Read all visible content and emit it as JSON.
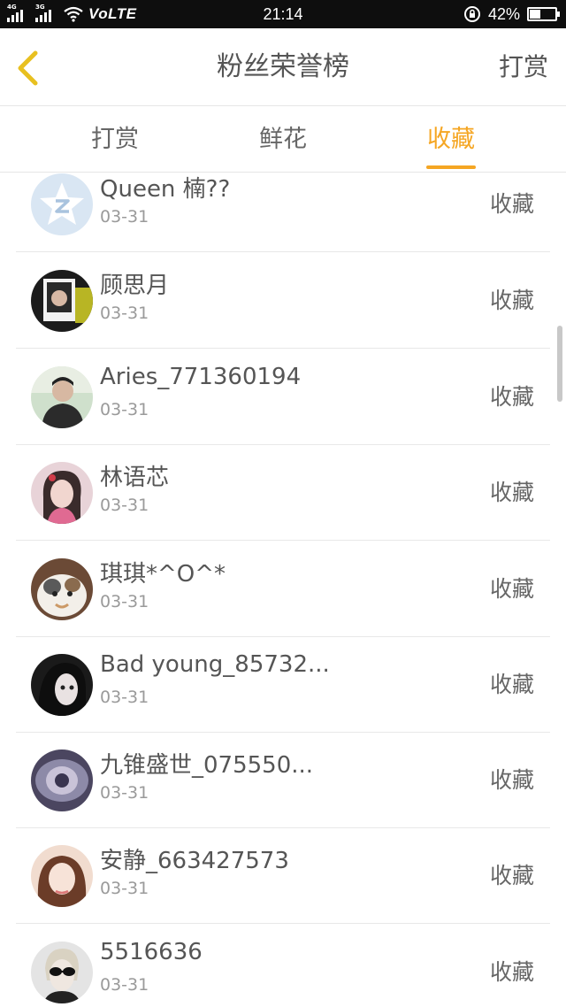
{
  "status_bar": {
    "sim1": "4G",
    "sim2": "3G",
    "network": "VoLTE",
    "time": "21:14",
    "battery": "42%",
    "battery_level": 0.42
  },
  "header": {
    "title": "粉丝荣誉榜",
    "right_action": "打赏"
  },
  "tabs": [
    {
      "label": "打赏",
      "active": false
    },
    {
      "label": "鲜花",
      "active": false
    },
    {
      "label": "收藏",
      "active": true
    }
  ],
  "list": [
    {
      "name": "Queen 楠??",
      "date": "03-31",
      "action": "收藏",
      "avatar": "default-q-avatar"
    },
    {
      "name": "顾思月",
      "date": "03-31",
      "action": "收藏",
      "avatar": "photo-avatar"
    },
    {
      "name": "Aries_771360194",
      "date": "03-31",
      "action": "收藏",
      "avatar": "photo-avatar"
    },
    {
      "name": "林语芯",
      "date": "03-31",
      "action": "收藏",
      "avatar": "photo-avatar"
    },
    {
      "name": "琪琪*^O^*",
      "date": "03-31",
      "action": "收藏",
      "avatar": "photo-avatar"
    },
    {
      "name": "Bad young_85732...",
      "date": "03-31",
      "action": "收藏",
      "avatar": "photo-avatar"
    },
    {
      "name": "九锥盛世_075550...",
      "date": "03-31",
      "action": "收藏",
      "avatar": "photo-avatar"
    },
    {
      "name": "安静_663427573",
      "date": "03-31",
      "action": "收藏",
      "avatar": "photo-avatar"
    },
    {
      "name": "5516636",
      "date": "03-31",
      "action": "收藏",
      "avatar": "photo-avatar"
    }
  ],
  "colors": {
    "accent": "#f5a623",
    "back_icon": "#e8c020",
    "status_bar": "#0e0e0e"
  }
}
